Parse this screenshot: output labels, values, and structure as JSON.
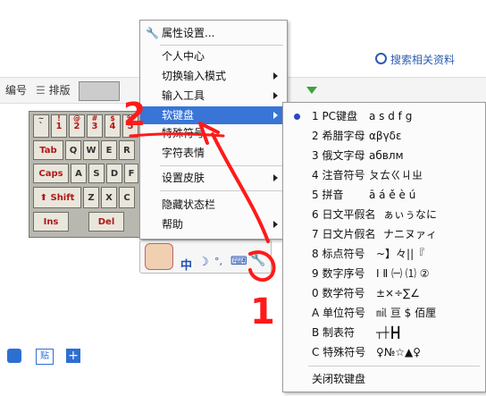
{
  "page": {
    "search_link": "搜索相关资料",
    "toolbar": {
      "item1": "编号",
      "item2": "排版"
    }
  },
  "soft_keyboard": {
    "rows": [
      [
        "~`",
        "1!",
        "2@",
        "3#",
        "4$",
        "5%"
      ],
      [
        "Tab",
        "Q",
        "W",
        "E",
        "R"
      ],
      [
        "Caps",
        "A",
        "S",
        "D",
        "F"
      ],
      [
        "Shift",
        "Z",
        "X",
        "C",
        "V"
      ],
      [
        "Ins",
        "Del"
      ]
    ]
  },
  "ime_bar": {
    "mode": "中",
    "moon": "☽",
    "punct": "°,",
    "kbd": "⌨",
    "tool": "🔧"
  },
  "context_menu": {
    "items": [
      {
        "label": "属性设置...",
        "icon": "wrench-icon"
      },
      {
        "label": "个人中心"
      },
      {
        "label": "切换输入模式",
        "submenu": true
      },
      {
        "label": "输入工具",
        "submenu": true
      },
      {
        "label": "软键盘",
        "submenu": true,
        "selected": true
      },
      {
        "label": "特殊符号"
      },
      {
        "label": "字符表情"
      },
      {
        "label": "设置皮肤",
        "submenu": true
      },
      {
        "label": "隐藏状态栏"
      },
      {
        "label": "帮助",
        "submenu": true
      }
    ]
  },
  "soft_keyboard_submenu": {
    "items": [
      {
        "label": "1 PC键盘",
        "sample": "a s d f g",
        "checked": true
      },
      {
        "label": "2 希腊字母",
        "sample": "αβγδε"
      },
      {
        "label": "3 俄文字母",
        "sample": "абвлм"
      },
      {
        "label": "4 注音符号",
        "sample": "ㄆㄊㄍㄐㄓ"
      },
      {
        "label": "5 拼音",
        "sample": "ā á ě è ú"
      },
      {
        "label": "6 日文平假名",
        "sample": "ぁぃぅなに"
      },
      {
        "label": "7 日文片假名",
        "sample": "ナニヌァィ"
      },
      {
        "label": "8 标点符号",
        "sample": "~】々||『"
      },
      {
        "label": "9 数字序号",
        "sample": "Ⅰ Ⅱ ㈠ ⑴ ②"
      },
      {
        "label": "0 数学符号",
        "sample": "±×÷∑∠"
      },
      {
        "label": "A 单位符号",
        "sample": "㏕ 亘 $ 佰厘"
      },
      {
        "label": "B 制表符",
        "sample": "┬┼┣┫"
      },
      {
        "label": "C 特殊符号",
        "sample": "♀№☆▲♀"
      },
      {
        "label": "关闭软键盘"
      }
    ]
  },
  "annotations": {
    "step1": "1",
    "step2": "2"
  },
  "colors": {
    "selection": "#3875d7",
    "annotation": "#ff1a1a"
  }
}
